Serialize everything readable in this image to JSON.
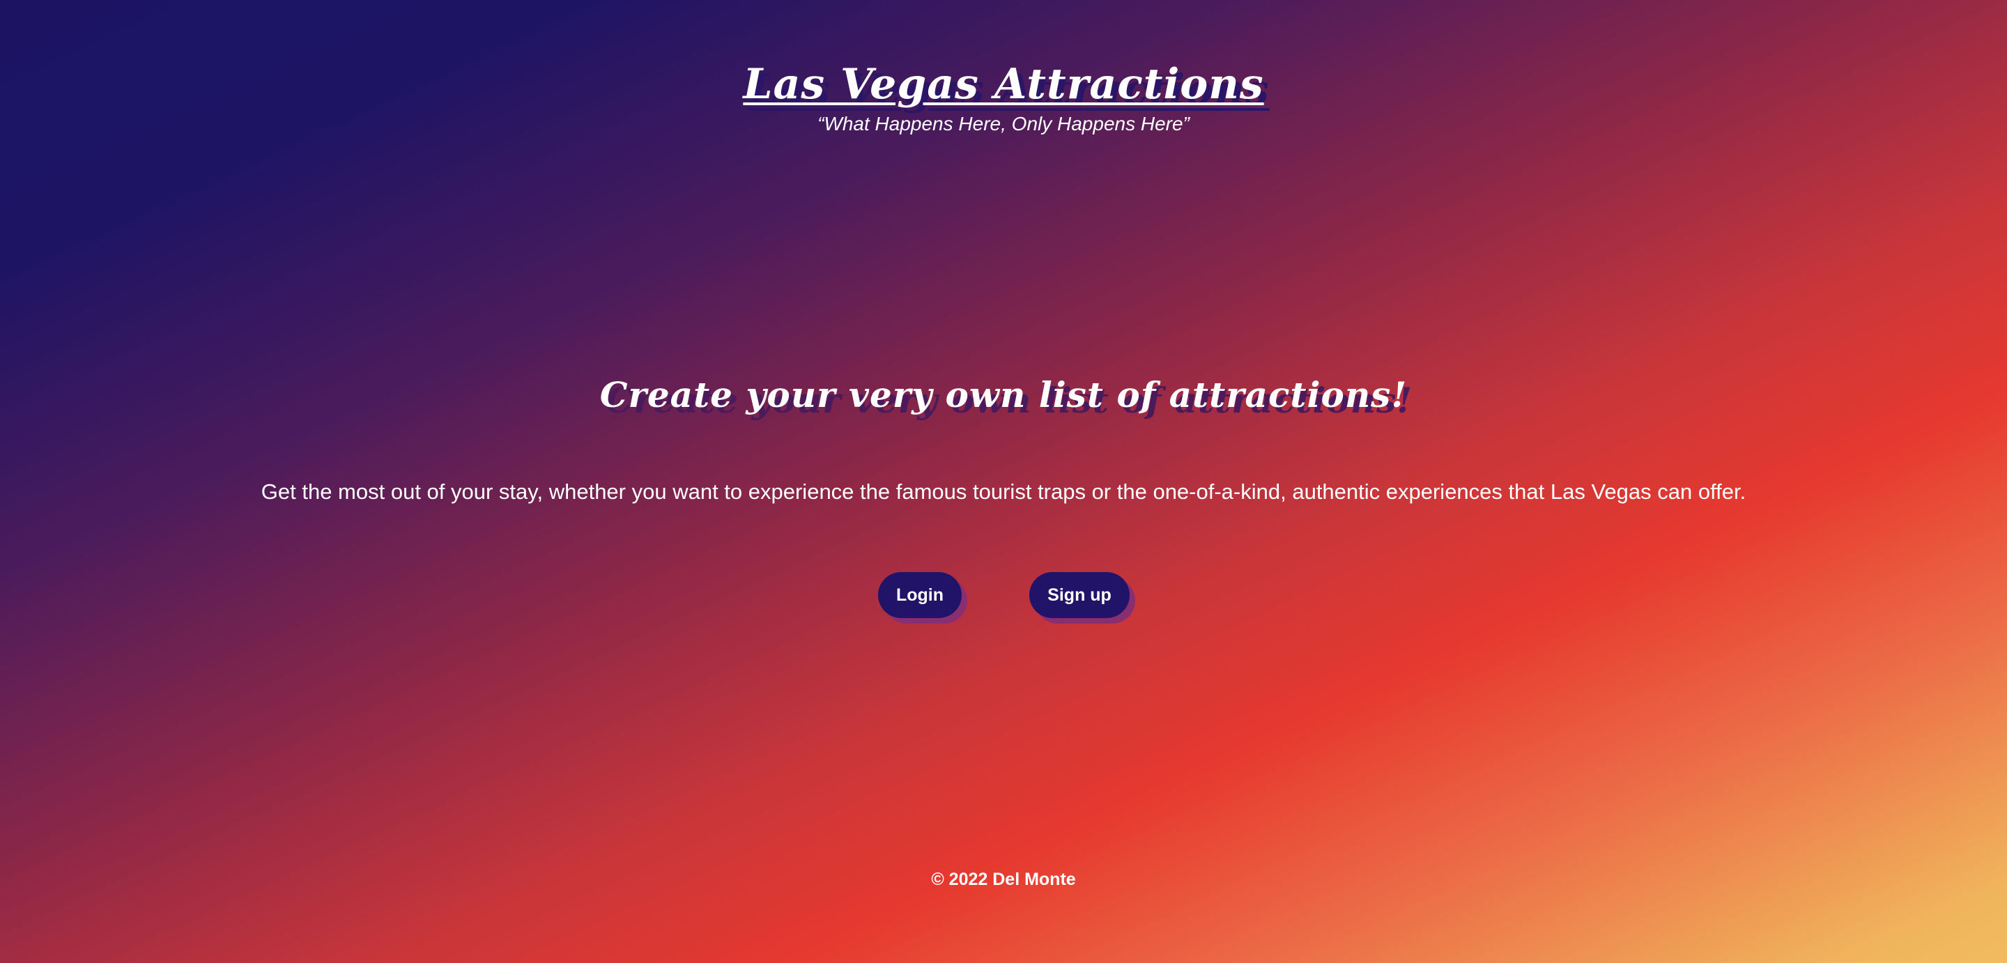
{
  "header": {
    "title": "Las Vegas Attractions",
    "tagline": "“What Happens Here, Only Happens Here”"
  },
  "hero": {
    "heading": "Create your very own list of attractions!",
    "body": "Get the most out of your stay, whether you want to experience the famous tourist traps or the one-of-a-kind, authentic experiences that Las Vegas can offer."
  },
  "actions": {
    "login_label": "Login",
    "signup_label": "Sign up"
  },
  "footer": {
    "copyright": "© 2022 Del Monte"
  },
  "colors": {
    "button_bg": "#211468",
    "button_shadow": "#8a2e72",
    "gradient_start": "#1c1463",
    "gradient_mid": "#e6392f",
    "gradient_end": "#f2bb5e",
    "text": "#ffffff"
  }
}
